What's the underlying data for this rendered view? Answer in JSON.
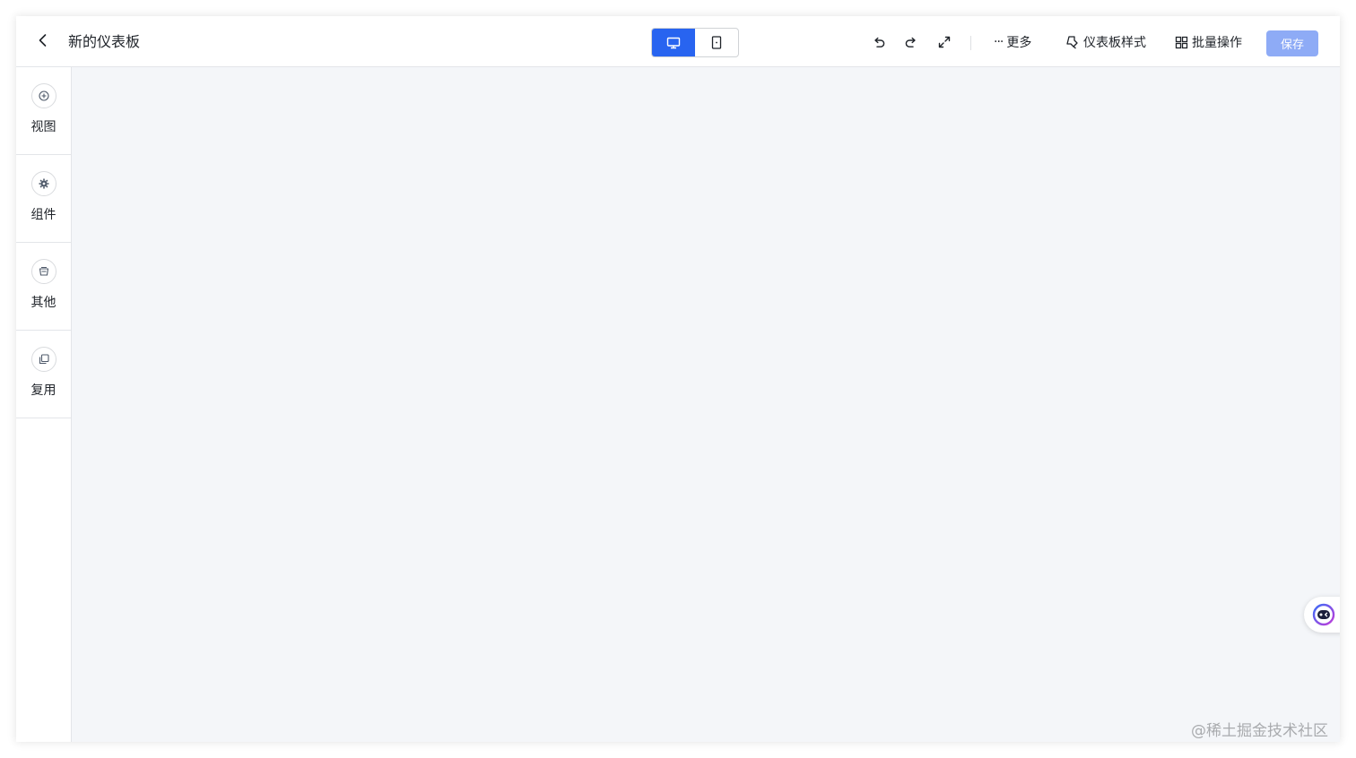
{
  "header": {
    "back_icon": "chevron-left-icon",
    "title": "新的仪表板",
    "device_modes": [
      {
        "id": "desktop",
        "icon": "desktop-icon",
        "active": true
      },
      {
        "id": "mobile",
        "icon": "mobile-icon",
        "active": false
      }
    ],
    "tools": [
      {
        "id": "undo",
        "icon": "undo-icon"
      },
      {
        "id": "redo",
        "icon": "redo-icon"
      },
      {
        "id": "fullscreen",
        "icon": "expand-icon"
      }
    ],
    "more_label": "更多",
    "style_label": "仪表板样式",
    "batch_label": "批量操作",
    "save_label": "保存",
    "save_enabled": false
  },
  "sidebar": {
    "items": [
      {
        "label": "视图",
        "icon": "plus-circle-icon"
      },
      {
        "label": "组件",
        "icon": "gear-icon"
      },
      {
        "label": "其他",
        "icon": "box-icon"
      },
      {
        "label": "复用",
        "icon": "copy-icon"
      }
    ]
  },
  "assistant": {
    "icon": "assistant-bot-icon"
  },
  "watermark": "@稀土掘金技术社区",
  "colors": {
    "accent": "#2864f0",
    "save_disabled": "#8eabf6",
    "canvas_bg": "#f4f6f9",
    "text": "#1f2329"
  }
}
